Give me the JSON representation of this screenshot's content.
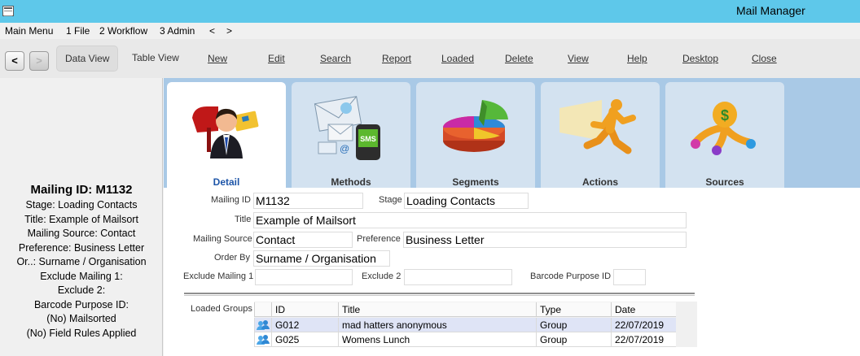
{
  "window": {
    "title": "Mail Manager"
  },
  "menu": [
    "Main Menu",
    "1 File",
    "2 Workflow",
    "3 Admin",
    "<",
    ">"
  ],
  "toolbar": {
    "back": "<",
    "forward": ">",
    "data_view": "Data View",
    "table_view": "Table View",
    "buttons": [
      "New",
      "Edit",
      "Search",
      "Report",
      "Loaded",
      "Delete",
      "View",
      "Help",
      "Desktop",
      "Close"
    ]
  },
  "summary": {
    "mailing_id": "Mailing ID: M1132",
    "lines": [
      "Stage: Loading Contacts",
      "Title: Example of Mailsort",
      "Mailing Source: Contact",
      "Preference: Business Letter",
      "Or..: Surname / Organisation",
      "Exclude Mailing 1:",
      "Exclude 2:",
      "Barcode Purpose ID:",
      "(No) Mailsorted",
      "(No) Field Rules Applied"
    ]
  },
  "tabs": [
    {
      "label": "Detail",
      "icon": "person-mailbox-icon",
      "active": true
    },
    {
      "label": "Methods",
      "icon": "email-sms-icon",
      "active": false
    },
    {
      "label": "Segments",
      "icon": "pie-chart-icon",
      "active": false
    },
    {
      "label": "Actions",
      "icon": "running-man-icon",
      "active": false
    },
    {
      "label": "Sources",
      "icon": "money-bag-icon",
      "active": false
    }
  ],
  "form": {
    "mailing_id_label": "Mailing ID",
    "mailing_id": "M1132",
    "stage_label": "Stage",
    "stage": "Loading Contacts",
    "title_label": "Title",
    "title": "Example of Mailsort",
    "source_label": "Mailing Source",
    "source": "Contact",
    "preference_label": "Preference",
    "preference": "Business Letter",
    "order_label": "Order By",
    "order": "Surname / Organisation",
    "exclude1_label": "Exclude Mailing 1",
    "exclude1": "",
    "exclude2_label": "Exclude 2",
    "exclude2": "",
    "barcode_label": "Barcode Purpose ID",
    "barcode": ""
  },
  "loaded_groups": {
    "label": "Loaded Groups",
    "columns": [
      "ID",
      "Title",
      "Type",
      "Date"
    ],
    "rows": [
      [
        "G012",
        "mad hatters anonymous",
        "Group",
        "22/07/2019"
      ],
      [
        "G025",
        "Womens Lunch",
        "Group",
        "22/07/2019"
      ]
    ]
  },
  "colors": {
    "titlebar": "#5ec8ea",
    "tabstrip": "#a9c9e6",
    "tab_inactive": "#d3e2f0",
    "tab_active_label": "#1d55a8",
    "selected_row": "#dfe4f6"
  }
}
